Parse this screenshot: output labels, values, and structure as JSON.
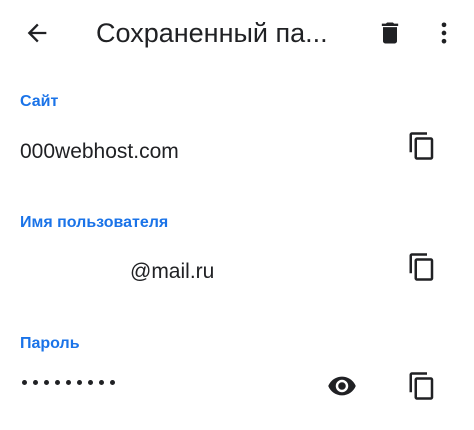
{
  "toolbar": {
    "title": "Сохраненный па...",
    "back_icon": "arrow-back-icon",
    "delete_icon": "trash-icon",
    "more_icon": "more-vert-icon"
  },
  "site": {
    "label": "Сайт",
    "value": "000webhost.com"
  },
  "username": {
    "label": "Имя пользователя",
    "value": "@mail.ru"
  },
  "password": {
    "label": "Пароль",
    "mask_length": 9
  },
  "colors": {
    "accent": "#1a73e8",
    "text": "#202124",
    "icon": "#202124"
  }
}
